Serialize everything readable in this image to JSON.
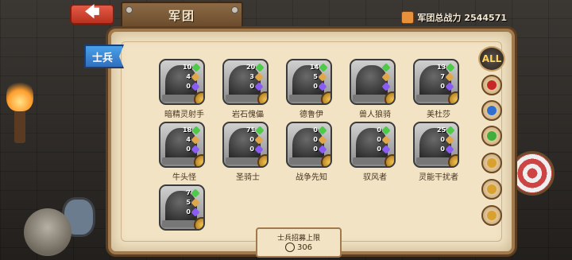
{
  "header": {
    "back_label": "🡄",
    "title": "军团",
    "power_label": "军团总战力",
    "power_value": "2544571"
  },
  "tab": {
    "label": "士兵"
  },
  "filters": {
    "all_label": "ALL",
    "icons": [
      "fire-class-icon",
      "water-class-icon",
      "nature-class-icon",
      "gold-class-icon",
      "gold-class-icon",
      "gold-class-icon"
    ]
  },
  "units": [
    {
      "name": "暗精灵射手",
      "stats": [
        "10",
        "4",
        "0"
      ]
    },
    {
      "name": "岩石傀儡",
      "stats": [
        "20",
        "3",
        "0"
      ]
    },
    {
      "name": "德鲁伊",
      "stats": [
        "14",
        "5",
        "0"
      ]
    },
    {
      "name": "兽人狼骑",
      "stats": [
        "",
        "",
        ""
      ]
    },
    {
      "name": "美杜莎",
      "stats": [
        "13",
        "7",
        "0"
      ]
    },
    {
      "name": "牛头怪",
      "stats": [
        "18",
        "4",
        "0"
      ]
    },
    {
      "name": "圣骑士",
      "stats": [
        "71",
        "0",
        "0"
      ]
    },
    {
      "name": "战争先知",
      "stats": [
        "0",
        "0",
        "0"
      ]
    },
    {
      "name": "驭风者",
      "stats": [
        "0",
        "0",
        "0"
      ]
    },
    {
      "name": "灵能干扰者",
      "stats": [
        "25",
        "0",
        "0"
      ]
    },
    {
      "name": "",
      "stats": [
        "7",
        "5",
        "0"
      ]
    }
  ],
  "cap": {
    "label": "士兵招募上限",
    "value": "306"
  },
  "colors": {
    "back": "#c9412c",
    "tab": "#3b86d4",
    "parchment": "#f1e3c4"
  }
}
